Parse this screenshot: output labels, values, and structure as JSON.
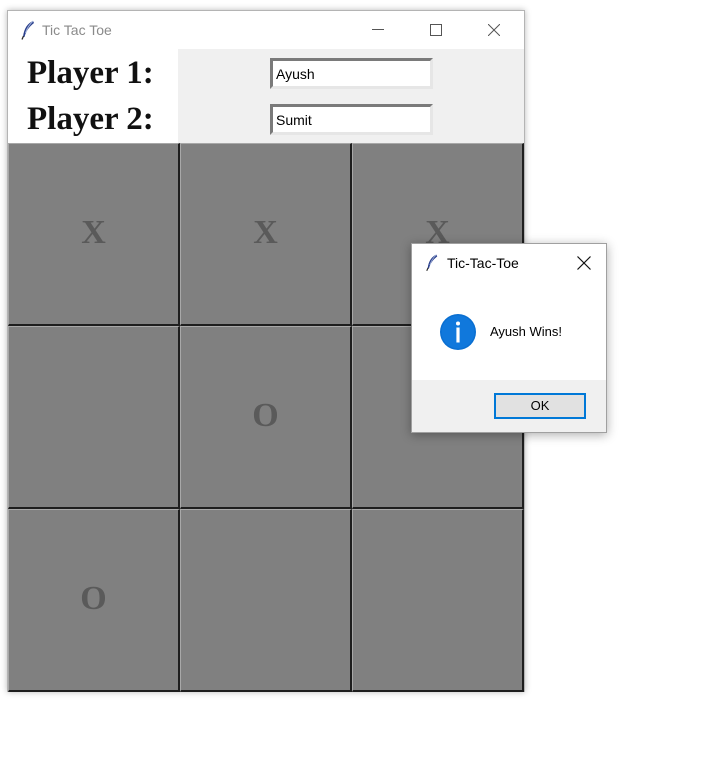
{
  "window": {
    "title": "Tic Tac Toe"
  },
  "players": {
    "player1_label": "Player 1:",
    "player1_name": "Ayush",
    "player2_label": "Player 2:",
    "player2_name": "Sumit"
  },
  "board": {
    "cells": [
      [
        "X",
        "X",
        "X"
      ],
      [
        "",
        "O",
        ""
      ],
      [
        "O",
        "",
        ""
      ]
    ]
  },
  "dialog": {
    "title": "Tic-Tac-Toe",
    "message": "Ayush Wins!",
    "ok_label": "OK",
    "icon": "info-icon"
  },
  "colors": {
    "cell_background": "#808080",
    "mark_color": "#5a5a5a",
    "dialog_accent": "#0078d7"
  }
}
